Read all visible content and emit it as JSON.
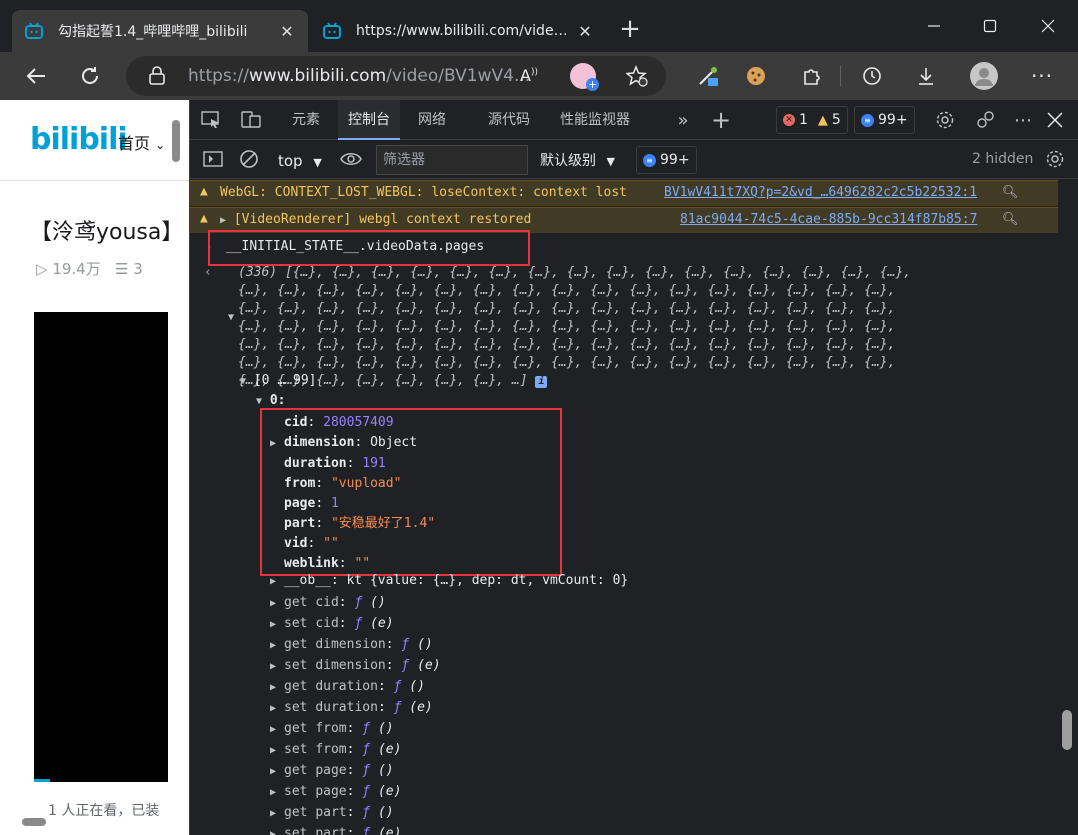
{
  "browser": {
    "tabs": [
      {
        "title": "勾指起誓1.4_哔哩哔哩_bilibili",
        "active": true
      },
      {
        "title": "https://www.bilibili.com/video/BV1w",
        "active": false
      }
    ],
    "url_prefix": "https://",
    "url_domain": "www.bilibili.com",
    "url_path": "/video/BV1wV4...",
    "icons": [
      "back-icon",
      "refresh-icon",
      "lock-icon",
      "read-aloud-icon",
      "favorite-add-icon",
      "eyedropper-icon",
      "cookie-icon",
      "extensions-icon",
      "history-icon",
      "download-icon",
      "profile-icon",
      "more-icon"
    ]
  },
  "page": {
    "logo": "bilibili",
    "home_nav": "首页",
    "video_title": "【泠鸢yousa】",
    "views": "19.4万",
    "danmaku": "3",
    "viewers": "1 人正在看，已装"
  },
  "devtools": {
    "tabs": [
      "元素",
      "控制台",
      "网络",
      "源代码",
      "性能监视器"
    ],
    "active_tab": "控制台",
    "error_count": "1",
    "warning_count": "5",
    "message_count": "99+",
    "context": "top",
    "filter_placeholder": "筛选器",
    "level": "默认级别",
    "filter_messages": "99+",
    "hidden": "2 hidden"
  },
  "console": {
    "warnings": [
      {
        "text": "WebGL: CONTEXT_LOST_WEBGL: loseContext: context lost",
        "source": "BV1wV411t7XQ?p=2&vd_…6496282c2c5b22532:1"
      },
      {
        "text": "[VideoRenderer] webgl context restored",
        "source": "81ac9044-74c5-4cae-885b-9cc314f87b85:7"
      }
    ],
    "input": "__INITIAL_STATE__.videoData.pages",
    "array_summary_lines": [
      "(336) [{…}, {…}, {…}, {…}, {…}, {…}, {…}, {…}, {…}, {…}, {…}, {…}, {…}, {…}, {…}, {…},",
      "{…}, {…}, {…}, {…}, {…}, {…}, {…}, {…}, {…}, {…}, {…}, {…}, {…}, {…}, {…}, {…}, {…},",
      "{…}, {…}, {…}, {…}, {…}, {…}, {…}, {…}, {…}, {…}, {…}, {…}, {…}, {…}, {…}, {…}, {…},",
      "{…}, {…}, {…}, {…}, {…}, {…}, {…}, {…}, {…}, {…}, {…}, {…}, {…}, {…}, {…}, {…}, {…},",
      "{…}, {…}, {…}, {…}, {…}, {…}, {…}, {…}, {…}, {…}, {…}, {…}, {…}, {…}, {…}, {…}, {…},",
      "{…}, {…}, {…}, {…}, {…}, {…}, {…}, {…}, {…}, {…}, {…}, {…}, {…}, {…}, {…}, {…}, {…},"
    ],
    "array_summary_last": "{…}, {…}, {…}, {…}, {…}, {…}, {…}, …]",
    "group": "[0 … 99]",
    "index": "0:",
    "props": [
      {
        "key": "cid",
        "value": "280057409",
        "type": "num"
      },
      {
        "key": "dimension",
        "value": "Object",
        "type": "obj"
      },
      {
        "key": "duration",
        "value": "191",
        "type": "num"
      },
      {
        "key": "from",
        "value": "\"vupload\"",
        "type": "str"
      },
      {
        "key": "page",
        "value": "1",
        "type": "num"
      },
      {
        "key": "part",
        "value": "\"安稳最好了1.4\"",
        "type": "str"
      },
      {
        "key": "vid",
        "value": "\"\"",
        "type": "str"
      },
      {
        "key": "weblink",
        "value": "\"\"",
        "type": "str"
      }
    ],
    "ob_line": "__ob__: kt {value: {…}, dep: dt, vmCount: 0}",
    "accessors": [
      {
        "kind": "get",
        "name": "cid",
        "sig": "()"
      },
      {
        "kind": "set",
        "name": "cid",
        "sig": "(e)"
      },
      {
        "kind": "get",
        "name": "dimension",
        "sig": "()"
      },
      {
        "kind": "set",
        "name": "dimension",
        "sig": "(e)"
      },
      {
        "kind": "get",
        "name": "duration",
        "sig": "()"
      },
      {
        "kind": "set",
        "name": "duration",
        "sig": "(e)"
      },
      {
        "kind": "get",
        "name": "from",
        "sig": "()"
      },
      {
        "kind": "set",
        "name": "from",
        "sig": "(e)"
      },
      {
        "kind": "get",
        "name": "page",
        "sig": "()"
      },
      {
        "kind": "set",
        "name": "page",
        "sig": "(e)"
      },
      {
        "kind": "get",
        "name": "part",
        "sig": "()"
      },
      {
        "kind": "set",
        "name": "part",
        "sig": "(e)"
      }
    ],
    "fn_symbol": "ƒ"
  },
  "colors": {
    "warning": "#f2c55c",
    "link": "#7cacf8",
    "number": "#9980ff",
    "string": "#f28b54",
    "highlight_box": "#e5353a",
    "bilibili_blue": "#00a1d6"
  }
}
